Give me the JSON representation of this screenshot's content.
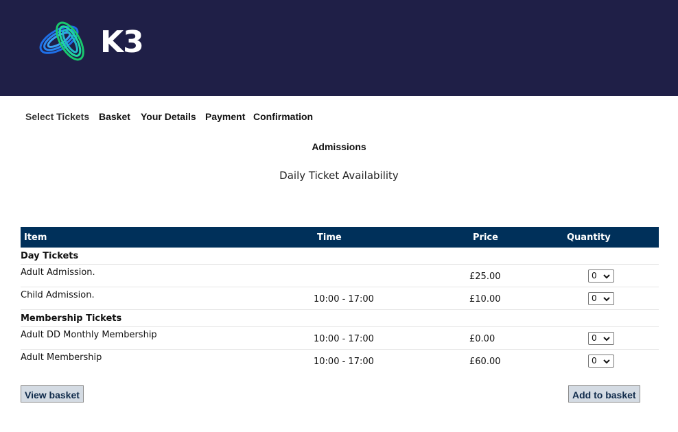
{
  "brand": {
    "logo_text": "K3",
    "colors": {
      "header_bg": "#1f1f47",
      "table_header_bg": "#00305a",
      "logo_blue": "#1e6fe8",
      "logo_green": "#19c96d"
    }
  },
  "steps": [
    {
      "label": "Select Tickets"
    },
    {
      "label": "Basket"
    },
    {
      "label": "Your Details"
    },
    {
      "label": "Payment"
    },
    {
      "label": "Confirmation"
    }
  ],
  "section_title": "Admissions",
  "subtitle": "Daily Ticket Availability",
  "table": {
    "headers": {
      "item": "Item",
      "time": "Time",
      "price": "Price",
      "quantity": "Quantity"
    },
    "groups": [
      {
        "label": "Day Tickets",
        "rows": [
          {
            "item": "Adult Admission.",
            "time": "",
            "price": "£25.00",
            "quantity": "0"
          },
          {
            "item": "Child Admission.",
            "time": "10:00 - 17:00",
            "price": "£10.00",
            "quantity": "0"
          }
        ]
      },
      {
        "label": "Membership Tickets",
        "rows": [
          {
            "item": "Adult DD Monthly Membership",
            "time": "10:00 - 17:00",
            "price": "£0.00",
            "quantity": "0"
          },
          {
            "item": "Adult Membership",
            "time": "10:00 - 17:00",
            "price": "£60.00",
            "quantity": "0"
          }
        ]
      }
    ]
  },
  "actions": {
    "view_basket": "View basket",
    "add_to_basket": "Add to basket"
  }
}
